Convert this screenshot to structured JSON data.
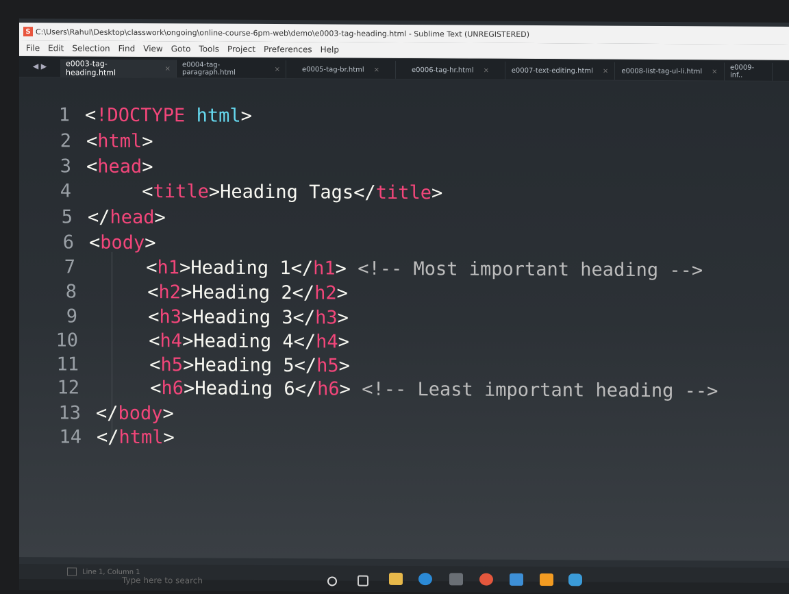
{
  "window": {
    "title": "C:\\Users\\Rahul\\Desktop\\classwork\\ongoing\\online-course-6pm-web\\demo\\e0003-tag-heading.html - Sublime Text (UNREGISTERED)",
    "logo_text": "S"
  },
  "menu": [
    "File",
    "Edit",
    "Selection",
    "Find",
    "View",
    "Goto",
    "Tools",
    "Project",
    "Preferences",
    "Help"
  ],
  "tab_nav": "◀ ▶",
  "tabs": [
    {
      "label": "e0003-tag-heading.html",
      "close": "×"
    },
    {
      "label": "e0004-tag-paragraph.html",
      "close": "×"
    },
    {
      "label": "e0005-tag-br.html",
      "close": "×"
    },
    {
      "label": "e0006-tag-hr.html",
      "close": "×"
    },
    {
      "label": "e0007-text-editing.html",
      "close": "×"
    },
    {
      "label": "e0008-list-tag-ul-li.html",
      "close": "×"
    },
    {
      "label": "e0009-inf..",
      "close": ""
    }
  ],
  "code": {
    "l1": {
      "n": "1",
      "a": "<",
      "b": "!DOCTYPE",
      "c": " html",
      "d": ">"
    },
    "l2": {
      "n": "2",
      "a": "<",
      "b": "html",
      "c": ">"
    },
    "l3": {
      "n": "3",
      "a": "<",
      "b": "head",
      "c": ">"
    },
    "l4": {
      "n": "4",
      "a": "<",
      "b": "title",
      "c": ">",
      "d": "Heading Tags",
      "e": "</",
      "f": "title",
      "g": ">"
    },
    "l5": {
      "n": "5",
      "a": "</",
      "b": "head",
      "c": ">"
    },
    "l6": {
      "n": "6",
      "a": "<",
      "b": "body",
      "c": ">"
    },
    "l7": {
      "n": "7",
      "a": "<",
      "b": "h1",
      "c": ">",
      "d": "Heading 1",
      "e": "</",
      "f": "h1",
      "g": ">",
      "h": " <!-- Most important heading -->"
    },
    "l8": {
      "n": "8",
      "a": "<",
      "b": "h2",
      "c": ">",
      "d": "Heading 2",
      "e": "</",
      "f": "h2",
      "g": ">"
    },
    "l9": {
      "n": "9",
      "a": "<",
      "b": "h3",
      "c": ">",
      "d": "Heading 3",
      "e": "</",
      "f": "h3",
      "g": ">"
    },
    "l10": {
      "n": "10",
      "a": "<",
      "b": "h4",
      "c": ">",
      "d": "Heading 4",
      "e": "</",
      "f": "h4",
      "g": ">"
    },
    "l11": {
      "n": "11",
      "a": "<",
      "b": "h5",
      "c": ">",
      "d": "Heading 5",
      "e": "</",
      "f": "h5",
      "g": ">"
    },
    "l12": {
      "n": "12",
      "a": "<",
      "b": "h6",
      "c": ">",
      "d": "Heading 6",
      "e": "</",
      "f": "h6",
      "g": ">",
      "h": " <!-- Least important heading -->"
    },
    "l13": {
      "n": "13",
      "a": "</",
      "b": "body",
      "c": ">"
    },
    "l14": {
      "n": "14",
      "a": "</",
      "b": "html",
      "c": ">"
    }
  },
  "status": {
    "position": "Line 1, Column 1"
  },
  "taskbar": {
    "search": "Type here to search"
  },
  "colors": {
    "tag": "#f2467a",
    "attr": "#66d9ef",
    "comment": "#bcbcbc",
    "text": "#f8f8f2"
  }
}
